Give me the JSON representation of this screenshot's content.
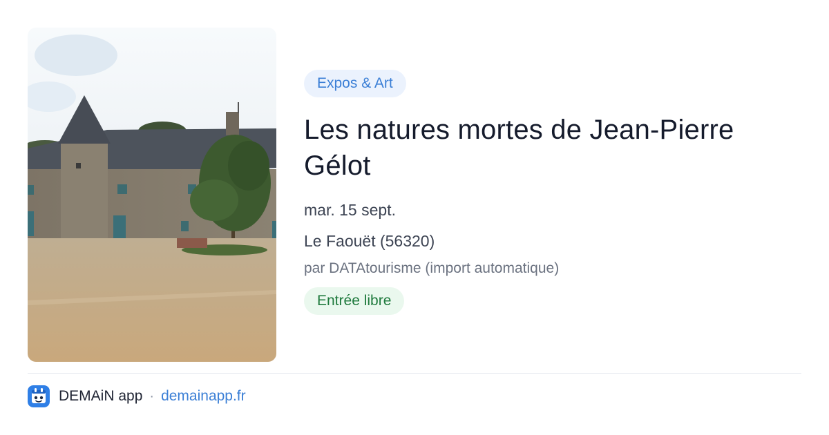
{
  "event": {
    "category": "Expos & Art",
    "title": "Les natures mortes de Jean-Pierre Gélot",
    "date": "mar. 15 sept.",
    "location": "Le Faouët (56320)",
    "organizer": "par DATAtourisme (import automatique)",
    "price": "Entrée libre"
  },
  "footer": {
    "brand": "DEMAiN app",
    "separator": "·",
    "domain": "demainapp.fr",
    "logo_icon": "demain-app-logo-icon"
  },
  "colors": {
    "accent": "#3b7fd6",
    "category_bg": "#ebf2fd",
    "price_text": "#1f7a3d",
    "price_bg": "#eaf8ee",
    "title": "#151b2c"
  }
}
